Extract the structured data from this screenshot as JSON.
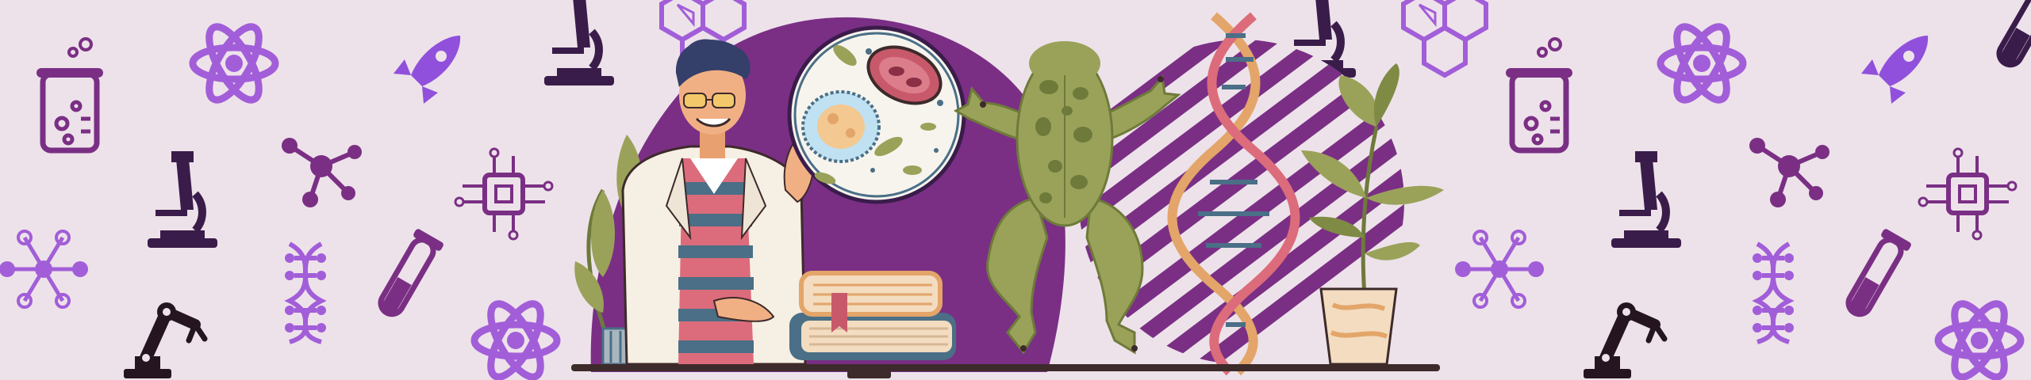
{
  "palette": {
    "background": "#ede2ea",
    "purple_dark": "#7a2f84",
    "purple_icon": "#8b4bd6",
    "purple_icon_light": "#a25ed8",
    "navy_icon": "#3a1c4a",
    "frog_green": "#9aa25a",
    "frog_spot": "#6e7a3a",
    "coat": "#f6efe4",
    "book_blue": "#4a6f86",
    "book_cream": "#f3dcc0",
    "dna_orange": "#e3a569",
    "dna_pink": "#dc6c7b",
    "bench": "#3d2a2a"
  },
  "background_icons": [
    "atom-icon",
    "beaker-icon",
    "rocket-icon",
    "microscope-icon",
    "molecule-icon",
    "circuit-chip-icon",
    "test-tube-icon",
    "dna-ladder-icon",
    "robot-arm-icon",
    "hexagon-molecule-icon",
    "network-molecule-icon"
  ],
  "scene_elements": [
    "scientist-figure",
    "microbe-lens",
    "frog-specimen",
    "dna-helix",
    "potted-plant",
    "book-stack",
    "lab-bench"
  ]
}
